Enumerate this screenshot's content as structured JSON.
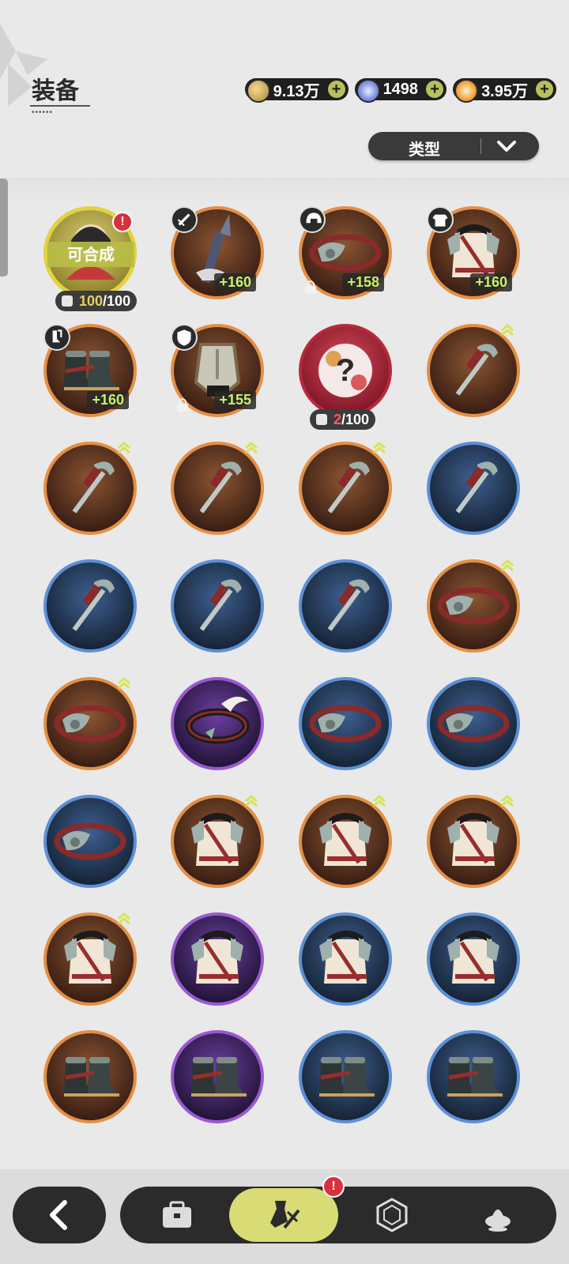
{
  "header": {
    "title": "装备"
  },
  "currencies": [
    {
      "name": "gold-coin",
      "value": "9.13万",
      "plus": "+"
    },
    {
      "name": "crystal",
      "value": "1498",
      "plus": "+"
    },
    {
      "name": "star-gem",
      "value": "3.95万",
      "plus": "+"
    }
  ],
  "sort": {
    "label": "类型"
  },
  "items": [
    {
      "rarity": "gold",
      "art": "character",
      "synth": "可合成",
      "frag_cur": "100",
      "frag_total": "/100",
      "alert": "!"
    },
    {
      "rarity": "orange",
      "art": "weapon-spear",
      "type_icon": "sword",
      "level": "+160"
    },
    {
      "rarity": "orange",
      "art": "belt",
      "type_icon": "helmet",
      "level": "+158",
      "locked": true
    },
    {
      "rarity": "orange",
      "art": "armor",
      "type_icon": "armor",
      "level": "+160"
    },
    {
      "rarity": "orange",
      "art": "boots",
      "type_icon": "boots",
      "level": "+160"
    },
    {
      "rarity": "orange",
      "art": "shield-relic",
      "type_icon": "shield",
      "level": "+155",
      "locked": true
    },
    {
      "rarity": "red",
      "art": "mystery",
      "frag_cur": "2",
      "frag_total": "/100"
    },
    {
      "rarity": "orange",
      "art": "blade",
      "upgrade": true
    },
    {
      "rarity": "orange",
      "art": "blade",
      "upgrade": true
    },
    {
      "rarity": "orange",
      "art": "blade",
      "upgrade": true
    },
    {
      "rarity": "orange",
      "art": "blade",
      "upgrade": true
    },
    {
      "rarity": "blue",
      "art": "blade"
    },
    {
      "rarity": "blue",
      "art": "blade"
    },
    {
      "rarity": "blue",
      "art": "blade"
    },
    {
      "rarity": "blue",
      "art": "blade"
    },
    {
      "rarity": "orange",
      "art": "belt",
      "upgrade": true
    },
    {
      "rarity": "orange",
      "art": "belt",
      "upgrade": true
    },
    {
      "rarity": "purple",
      "art": "headband"
    },
    {
      "rarity": "blue",
      "art": "belt"
    },
    {
      "rarity": "blue",
      "art": "belt"
    },
    {
      "rarity": "blue",
      "art": "belt"
    },
    {
      "rarity": "orange",
      "art": "armor",
      "upgrade": true
    },
    {
      "rarity": "orange",
      "art": "armor",
      "upgrade": true
    },
    {
      "rarity": "orange",
      "art": "armor",
      "upgrade": true
    },
    {
      "rarity": "orange",
      "art": "armor",
      "upgrade": true
    },
    {
      "rarity": "purple",
      "art": "armor"
    },
    {
      "rarity": "blue",
      "art": "armor"
    },
    {
      "rarity": "blue",
      "art": "armor"
    },
    {
      "rarity": "orange",
      "art": "boots"
    },
    {
      "rarity": "purple",
      "art": "boots"
    },
    {
      "rarity": "blue",
      "art": "boots"
    },
    {
      "rarity": "blue",
      "art": "boots"
    }
  ],
  "nav": {
    "back": "back-icon",
    "tabs": [
      "bag-icon",
      "equipment-icon",
      "gem-icon",
      "food-icon"
    ],
    "active": "equipment-icon",
    "alert": "!"
  },
  "colors": {
    "accent": "#d9dc74",
    "orange": "#e48f45",
    "blue": "#5c8fd6",
    "purple": "#9a58d1"
  }
}
